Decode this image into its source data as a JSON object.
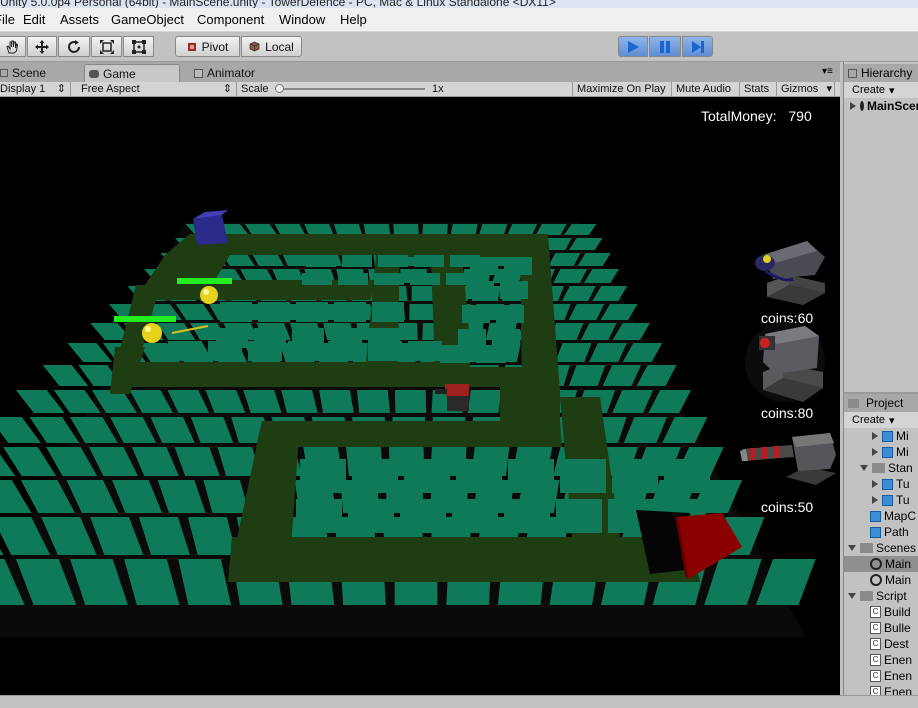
{
  "window": {
    "title": "Unity 5.0.0p4 Personal (64bit) - MainScene.unity - TowerDefence - PC, Mac & Linux Standalone <DX11>"
  },
  "menu": [
    "File",
    "Edit",
    "Assets",
    "GameObject",
    "Component",
    "Window",
    "Help"
  ],
  "toolbar": {
    "pivot_label": "Pivot",
    "local_label": "Local",
    "transform_tools": [
      "hand-icon",
      "move-icon",
      "rotate-icon",
      "scale-icon",
      "rect-icon"
    ],
    "play_icons": [
      "play-icon",
      "pause-icon",
      "step-icon"
    ],
    "play_color": "#1b66cc"
  },
  "tabs": [
    {
      "label": "Scene",
      "icon": "scene-icon",
      "active": false
    },
    {
      "label": "Game",
      "icon": "game-icon",
      "active": true
    },
    {
      "label": "Animator",
      "icon": "animator-icon",
      "active": false
    }
  ],
  "game_bar": {
    "display": "Display 1",
    "aspect": "Free Aspect",
    "scale_label": "Scale",
    "scale_value": "1x",
    "maximize": "Maximize On Play",
    "mute": "Mute Audio",
    "stats": "Stats",
    "gizmos": "Gizmos"
  },
  "game": {
    "total_money_label": "TotalMoney:",
    "total_money_value": "790",
    "towers": [
      {
        "cost_label": "coins:60",
        "icon": "turret-cannon-icon"
      },
      {
        "cost_label": "coins:80",
        "icon": "turret-laser-icon"
      },
      {
        "cost_label": "coins:50",
        "icon": "turret-missile-icon"
      }
    ],
    "colors": {
      "background": "#000000",
      "tile": "#0e7a5a",
      "path": "#1c3a12",
      "start_cube": "#2a2a8a",
      "end_cube": "#8a0000",
      "enemy": "#e6d21c",
      "health_bar": "#22ee22"
    }
  },
  "hierarchy": {
    "tab_label": "Hierarchy",
    "create_label": "Create",
    "root_item": "MainScene"
  },
  "project": {
    "tab_label": "Project",
    "create_label": "Create",
    "items": [
      {
        "label": "Mi",
        "icon": "cube-icon",
        "indent": 2,
        "arrow": "right"
      },
      {
        "label": "Mi",
        "icon": "cube-icon",
        "indent": 2,
        "arrow": "right"
      },
      {
        "label": "Stan",
        "icon": "folder-icon",
        "indent": 1,
        "arrow": "down"
      },
      {
        "label": "Tu",
        "icon": "cube-icon",
        "indent": 2,
        "arrow": "right"
      },
      {
        "label": "Tu",
        "icon": "cube-icon",
        "indent": 2,
        "arrow": "right"
      },
      {
        "label": "MapC",
        "icon": "cube-icon",
        "indent": 1,
        "arrow": ""
      },
      {
        "label": "Path",
        "icon": "cube-icon",
        "indent": 1,
        "arrow": ""
      },
      {
        "label": "Scenes",
        "icon": "folder-icon",
        "indent": 0,
        "arrow": "down"
      },
      {
        "label": "Main",
        "icon": "unity-scene-icon",
        "indent": 1,
        "arrow": "",
        "selected": true
      },
      {
        "label": "Main",
        "icon": "unity-scene-icon",
        "indent": 1,
        "arrow": ""
      },
      {
        "label": "Script",
        "icon": "folder-icon",
        "indent": 0,
        "arrow": "down"
      },
      {
        "label": "Build",
        "icon": "script-icon",
        "indent": 1,
        "arrow": ""
      },
      {
        "label": "Bulle",
        "icon": "script-icon",
        "indent": 1,
        "arrow": ""
      },
      {
        "label": "Dest",
        "icon": "script-icon",
        "indent": 1,
        "arrow": ""
      },
      {
        "label": "Enen",
        "icon": "script-icon",
        "indent": 1,
        "arrow": ""
      },
      {
        "label": "Enen",
        "icon": "script-icon",
        "indent": 1,
        "arrow": ""
      },
      {
        "label": "Enen",
        "icon": "script-icon",
        "indent": 1,
        "arrow": ""
      }
    ]
  }
}
